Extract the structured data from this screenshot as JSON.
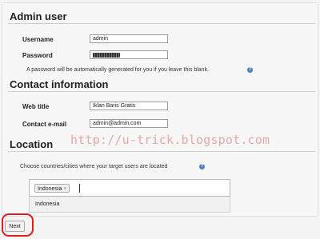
{
  "admin_section": {
    "title": "Admin user",
    "username_label": "Username",
    "username_value": "admin",
    "password_label": "Password",
    "password_hint": "A password will be automatically generated for you if you leave this blank."
  },
  "contact_section": {
    "title": "Contact information",
    "web_title_label": "Web title",
    "web_title_value": "Iklan Baris Gratis",
    "email_label": "Contact e-mail",
    "email_value": "admin@admin.com"
  },
  "location_section": {
    "title": "Location",
    "prompt": "Choose countries/cities where your target users are located",
    "selected_tag": "Indonesia",
    "tag_remove": "×",
    "suggestion": "Indonesia"
  },
  "watermark": "http://u-trick.blogspot.com",
  "next_label": "Next",
  "icons": {
    "help": "help-icon",
    "remove": "close-icon"
  },
  "colors": {
    "help_icon": "#4a7fc4",
    "highlight": "#e02020",
    "watermark": "#e8a8a8"
  }
}
